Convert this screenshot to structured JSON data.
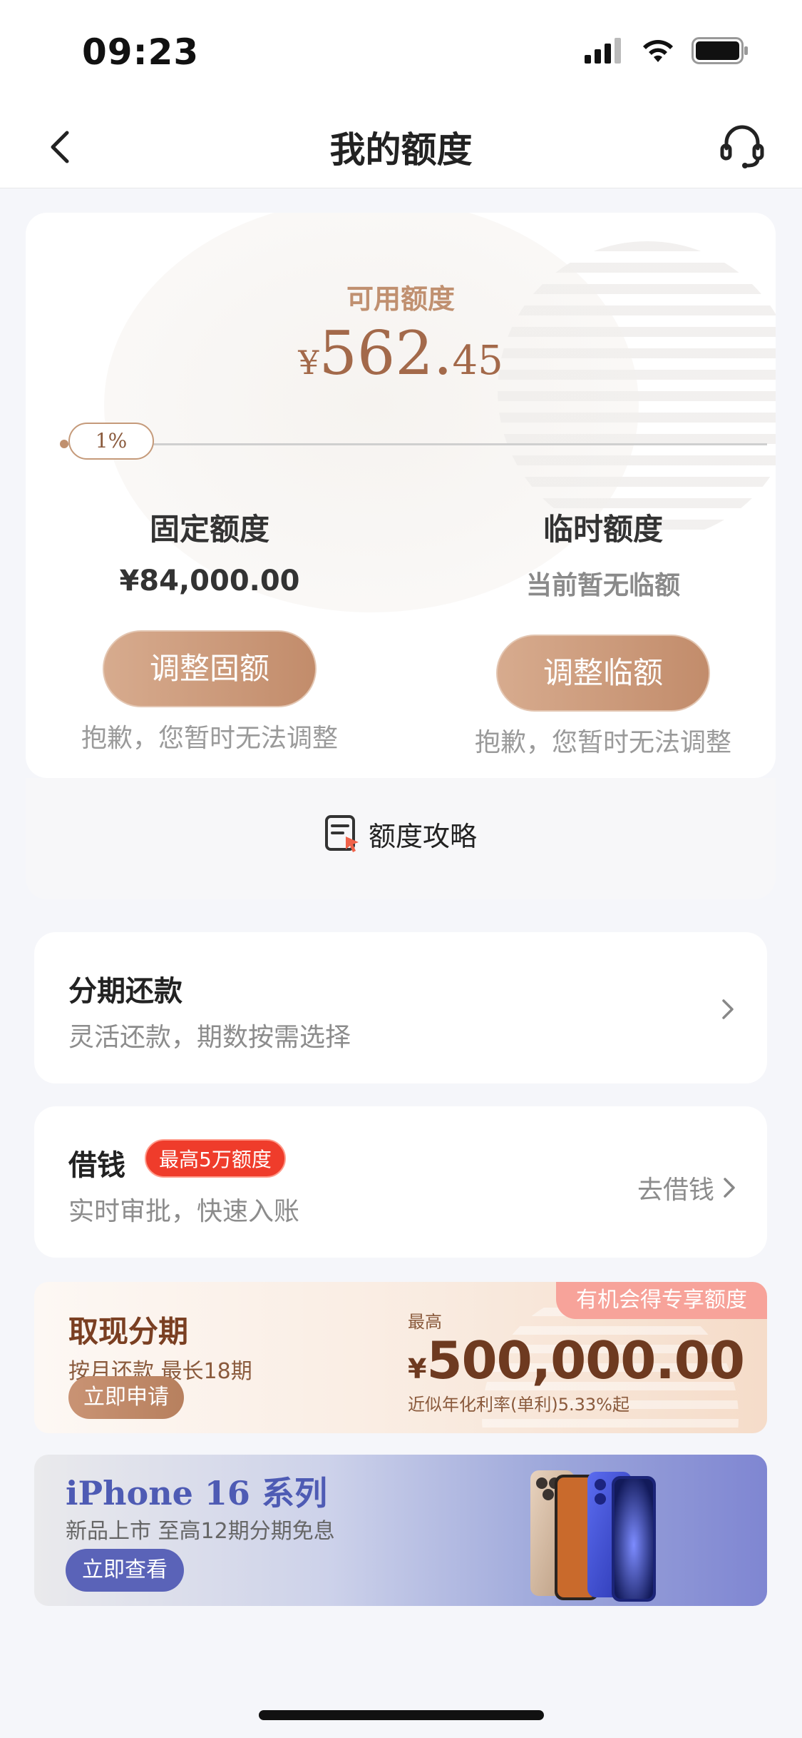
{
  "status_bar": {
    "time": "09:23"
  },
  "nav": {
    "title": "我的额度"
  },
  "quota": {
    "available_label": "可用额度",
    "currency": "¥",
    "amount_int": "562.",
    "amount_dec": "45",
    "progress_label": "1%",
    "progress": 0.01,
    "fixed": {
      "title": "固定额度",
      "value": "¥84,000.00",
      "button": "调整固额",
      "note": "抱歉，您暂时无法调整"
    },
    "temp": {
      "title": "临时额度",
      "value": "当前暂无临额",
      "button": "调整临额",
      "note": "抱歉，您暂时无法调整"
    }
  },
  "strategy": {
    "label": "额度攻略"
  },
  "installment": {
    "title": "分期还款",
    "subtitle": "灵活还款，期数按需选择"
  },
  "borrow": {
    "title": "借钱",
    "badge": "最高5万额度",
    "subtitle": "实时审批，快速入账",
    "action": "去借钱"
  },
  "cash_promo": {
    "title": "取现分期",
    "subtitle": "按月还款 最长18期",
    "button": "立即申请",
    "max_label": "最高",
    "currency": "¥",
    "amount": "500,000.00",
    "rate": "近似年化利率(单利)5.33%起",
    "tag": "有机会得专享额度"
  },
  "iphone_promo": {
    "title": "iPhone 16 系列",
    "subtitle": "新品上市 至高12期分期免息",
    "button": "立即查看"
  },
  "colors": {
    "accent_brown": "#a3694a",
    "button_brown": "#c28c6b",
    "badge_red": "#ef3c2b",
    "iphone_blue": "#4e5bb4"
  }
}
